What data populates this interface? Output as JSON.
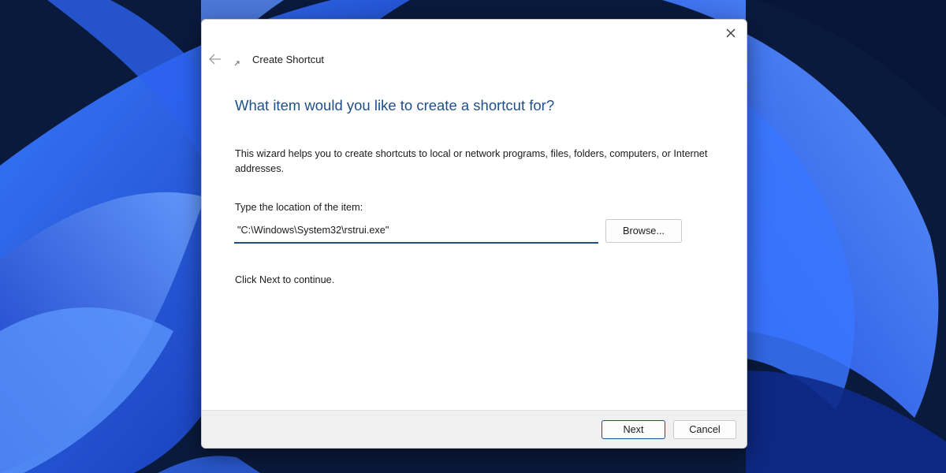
{
  "desktop": {
    "wallpaper": "windows-11-bloom-wallpaper"
  },
  "dialog": {
    "window_title": "Create Shortcut",
    "heading": "What item would you like to create a shortcut for?",
    "description": "This wizard helps you to create shortcuts to local or network programs, files, folders, computers, or Internet addresses.",
    "location_label": "Type the location of the item:",
    "location_value": "\"C:\\Windows\\System32\\rstrui.exe\"",
    "browse_label": "Browse...",
    "continue_text": "Click Next to continue.",
    "next_label": "Next",
    "cancel_label": "Cancel"
  },
  "icons": {
    "close": "close-icon",
    "back": "back-arrow-icon",
    "title": "shortcut-icon"
  },
  "colors": {
    "accent": "#1f4f8a",
    "desktop_background": "#0a1a3d",
    "wallpaper_blue": "#1e56e6",
    "dialog_background": "#ffffff",
    "footer_background": "#f0f0f0"
  }
}
